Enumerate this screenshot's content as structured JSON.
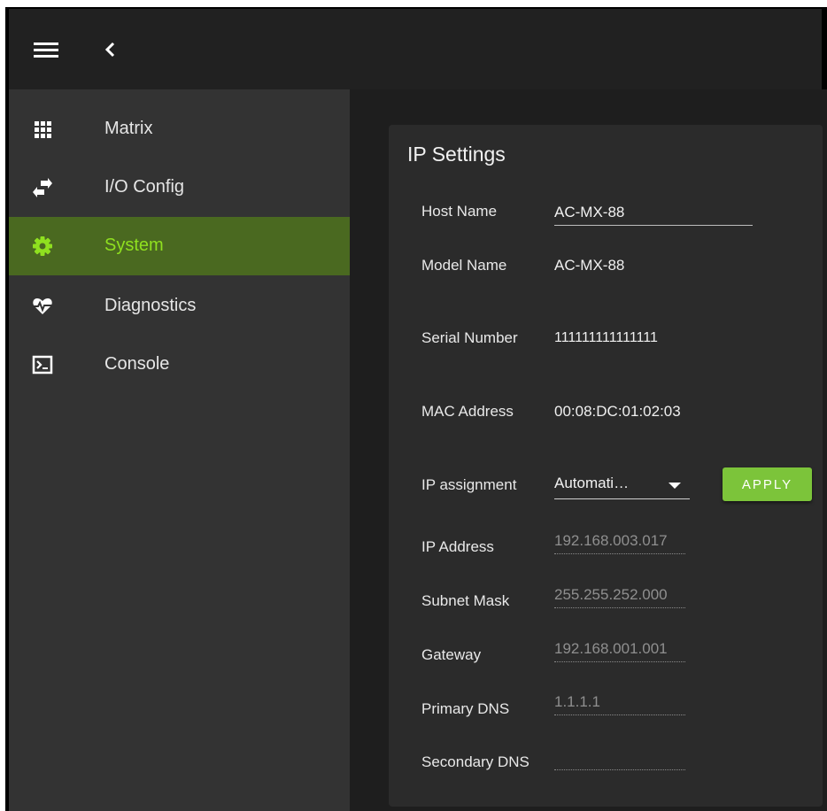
{
  "header": {
    "menu_icon": "hamburger-menu-icon",
    "back_icon": "chevron-left-icon"
  },
  "sidebar": {
    "items": [
      {
        "label": "Matrix",
        "icon": "grid-icon"
      },
      {
        "label": "I/O Config",
        "icon": "swap-arrows-icon"
      },
      {
        "label": "System",
        "icon": "gear-icon",
        "active": true
      },
      {
        "label": "Diagnostics",
        "icon": "heartbeat-icon"
      },
      {
        "label": "Console",
        "icon": "terminal-icon"
      }
    ]
  },
  "ip_settings": {
    "title": "IP Settings",
    "host_name": {
      "label": "Host Name",
      "value": "AC-MX-88"
    },
    "model_name": {
      "label": "Model Name",
      "value": "AC-MX-88"
    },
    "serial_number": {
      "label": "Serial Number",
      "value": "111111111111111"
    },
    "mac_address": {
      "label": "MAC Address",
      "value": "00:08:DC:01:02:03"
    },
    "ip_assignment": {
      "label": "IP assignment",
      "value": "Automati…"
    },
    "apply_label": "APPLY",
    "ip_address": {
      "label": "IP Address",
      "value": "192.168.003.017"
    },
    "subnet_mask": {
      "label": "Subnet Mask",
      "value": "255.255.252.000"
    },
    "gateway": {
      "label": "Gateway",
      "value": "192.168.001.001"
    },
    "primary_dns": {
      "label": "Primary DNS",
      "value": "1.1.1.1"
    },
    "secondary_dns": {
      "label": "Secondary DNS",
      "value": ""
    }
  },
  "colors": {
    "accent": "#7cc43a",
    "active_nav_bg": "#4a6920",
    "active_nav_text": "#8fe01f",
    "sidebar_bg": "#333333",
    "topbar_bg": "#212121",
    "card_bg": "#2b2b2b"
  }
}
